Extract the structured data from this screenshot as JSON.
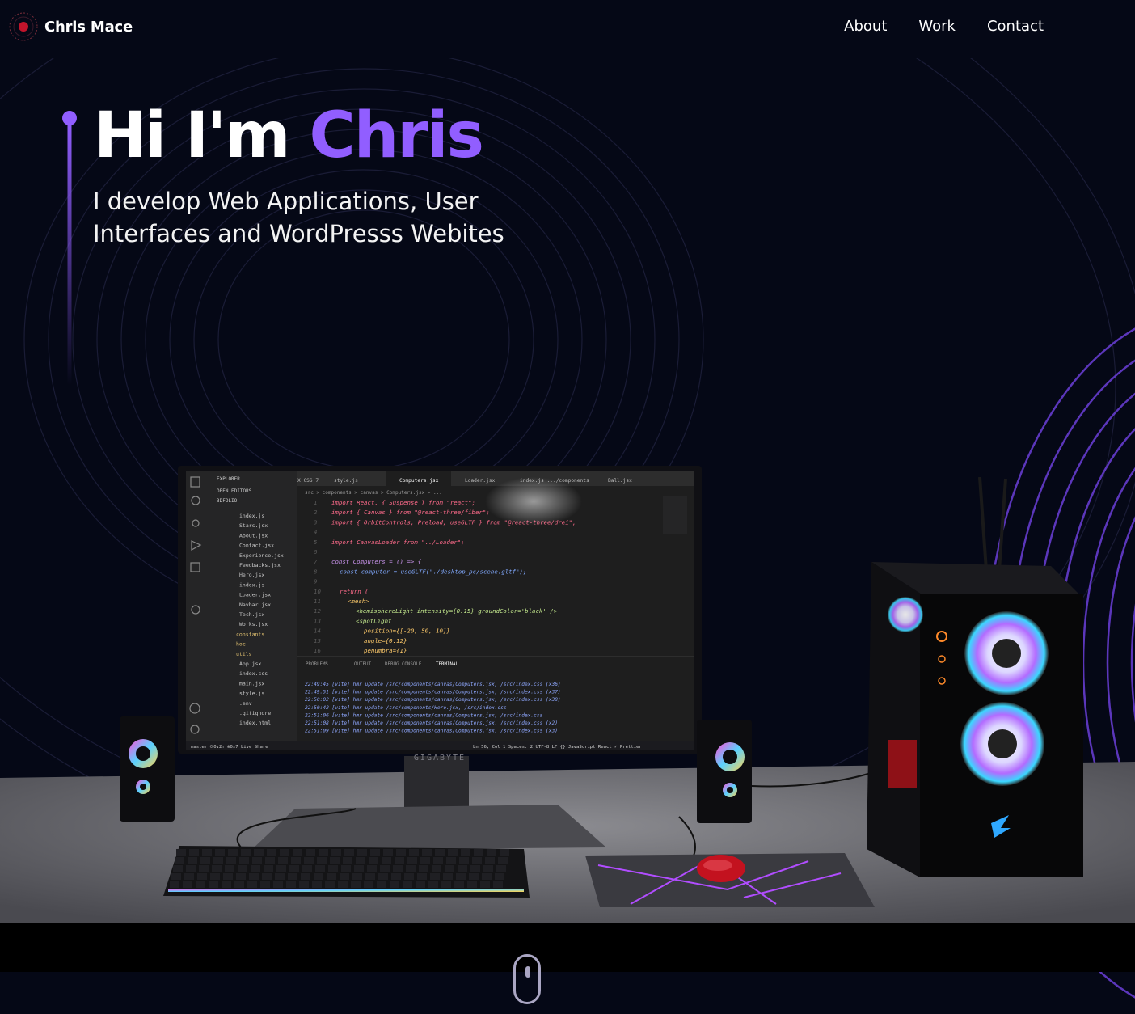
{
  "nav": {
    "brand": "Chris Mace",
    "links": [
      "About",
      "Work",
      "Contact"
    ]
  },
  "hero": {
    "greeting": "Hi I'm",
    "name": "Chris",
    "subtitle_line1": "I develop Web Applications, User",
    "subtitle_line2": "Interfaces and WordPresss Webites"
  },
  "scene": {
    "monitor_brand": "GIGABYTE",
    "editor": {
      "explorer_label": "EXPLORER",
      "open_editors": "OPEN EDITORS",
      "folder": "3DFOLIO",
      "files": [
        "index.js",
        "Stars.jsx",
        "About.jsx",
        "Contact.jsx",
        "Experience.jsx",
        "Feedbacks.jsx",
        "Hero.jsx",
        "index.js",
        "Loader.jsx",
        "Navbar.jsx",
        "Tech.jsx",
        "Works.jsx",
        "constants",
        "hoc",
        "utils",
        "App.jsx",
        "index.css",
        "main.jsx",
        "style.js",
        ".env",
        ".gitignore",
        "index.html"
      ],
      "tabs": [
        "X.CSS 7",
        "style.js",
        "Computers.jsx",
        "Loader.jsx",
        "index.js .../components",
        "Ball.jsx"
      ],
      "breadcrumb": "src > components > canvas > Computers.jsx > ...",
      "code": [
        "import React, { Suspense } from \"react\";",
        "import { Canvas } from \"@react-three/fiber\";",
        "import { OrbitControls, Preload, useGLTF } from \"@react-three/drei\";",
        "",
        "import CanvasLoader from \"../Loader\";",
        "",
        "const Computers = () => {",
        "  const computer = useGLTF(\"./desktop_pc/scene.gltf\");",
        "",
        "  return (",
        "    <mesh>",
        "      <hemisphereLight intensity={0.15} groundColor='black' />",
        "      <spotLight",
        "        position={[-20, 50, 10]}",
        "        angle={0.12}",
        "        penumbra={1}"
      ],
      "panel_tabs": [
        "PROBLEMS",
        "OUTPUT",
        "DEBUG CONSOLE",
        "TERMINAL"
      ],
      "terminal": [
        "22:49:45 [vite] hmr update /src/components/canvas/Computers.jsx, /src/index.css (x36)",
        "22:49:51 [vite] hmr update /src/components/canvas/Computers.jsx, /src/index.css (x37)",
        "22:50:02 [vite] hmr update /src/components/canvas/Computers.jsx, /src/index.css (x38)",
        "22:50:42 [vite] hmr update /src/components/Hero.jsx, /src/index.css",
        "22:51:06 [vite] hmr update /src/components/canvas/Computers.jsx, /src/index.css",
        "22:51:08 [vite] hmr update /src/components/canvas/Computers.jsx, /src/index.css (x2)",
        "22:51:09 [vite] hmr update /src/components/canvas/Computers.jsx, /src/index.css (x3)"
      ],
      "status_left": "master  ⟳0↓2↑  ⊗0⚠7  Live Share",
      "status_right": "Ln 56, Col 1   Spaces: 2   UTF-8   LF   {} JavaScript React   ✓ Prettier"
    }
  },
  "colors": {
    "background": "#050816",
    "accent": "#915eff",
    "secondary": "#aaa6c3"
  }
}
